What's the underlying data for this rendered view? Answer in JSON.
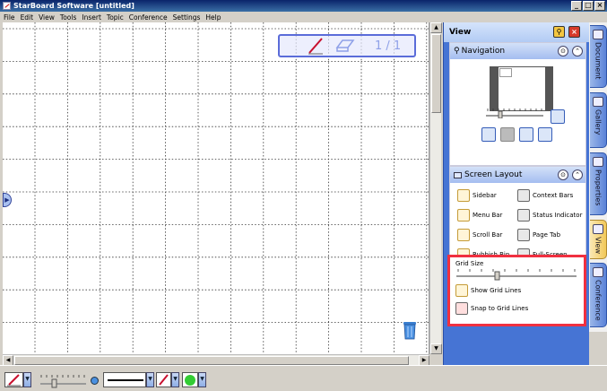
{
  "window": {
    "title": "StarBoard Software [untitled]",
    "min": "_",
    "max": "□",
    "close": "×"
  },
  "menu": [
    "File",
    "Edit",
    "View",
    "Tools",
    "Insert",
    "Topic",
    "Conference",
    "Settings",
    "Help"
  ],
  "page_indicator": {
    "label": "1 / 1"
  },
  "view_panel": {
    "title": "View",
    "navigation": {
      "title": "Navigation"
    },
    "screen_layout": {
      "title": "Screen Layout",
      "items": [
        {
          "label": "Sidebar"
        },
        {
          "label": "Context Bars"
        },
        {
          "label": "Menu Bar"
        },
        {
          "label": "Status Indicator"
        },
        {
          "label": "Scroll Bar"
        },
        {
          "label": "Page Tab"
        },
        {
          "label": "Rubbish Bin"
        },
        {
          "label": "Full-Screen"
        }
      ]
    },
    "grid": {
      "size_label": "Grid Size",
      "show_grid_label": "Show Grid Lines",
      "snap_grid_label": "Snap to Grid Lines",
      "size_level": 0.35
    }
  },
  "side_tabs": [
    {
      "label": "Document"
    },
    {
      "label": "Gallery"
    },
    {
      "label": "Properties"
    },
    {
      "label": "View"
    },
    {
      "label": "Conference"
    }
  ],
  "colors": {
    "pen": "#c8102e",
    "fill": "#33cc33",
    "highlight_box": "#f03040",
    "panel": "#4674d4"
  }
}
